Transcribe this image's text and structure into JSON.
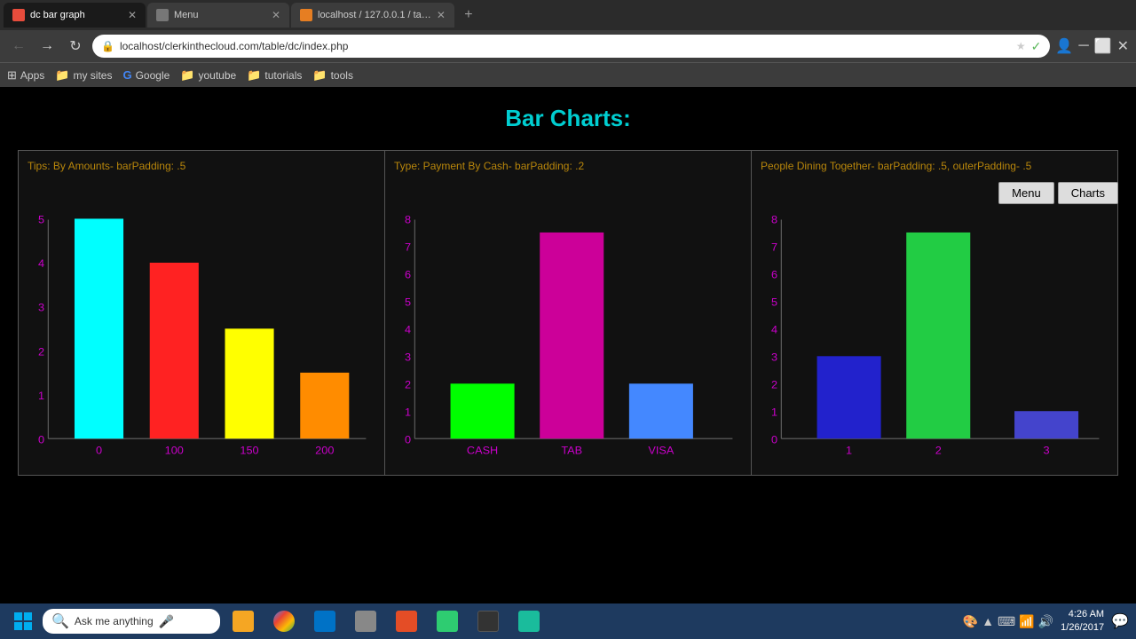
{
  "browser": {
    "tabs": [
      {
        "id": "tab1",
        "title": "dc bar graph",
        "favicon": "graph",
        "active": true,
        "url": "localhost/clerkinthecloud.com/table/dc/index.php"
      },
      {
        "id": "tab2",
        "title": "Menu",
        "favicon": "menu",
        "active": false,
        "url": ""
      },
      {
        "id": "tab3",
        "title": "localhost / 127.0.0.1 / ta…",
        "favicon": "server",
        "active": false,
        "url": ""
      }
    ],
    "address": "localhost/clerkinthecloud.com/table/dc/index.php",
    "bookmarks": [
      {
        "label": "Apps",
        "type": "apps"
      },
      {
        "label": "my sites",
        "type": "folder"
      },
      {
        "label": "Google",
        "type": "google"
      },
      {
        "label": "youtube",
        "type": "folder"
      },
      {
        "label": "tutorials",
        "type": "folder"
      },
      {
        "label": "tools",
        "type": "folder"
      }
    ]
  },
  "page": {
    "title": "Bar Charts:",
    "buttons": {
      "menu": "Menu",
      "charts": "Charts"
    }
  },
  "charts": [
    {
      "id": "chart1",
      "label": "Tips: By Amounts- barPadding: .5",
      "yMax": 5,
      "yTicks": [
        0,
        1,
        2,
        3,
        4,
        5
      ],
      "bars": [
        {
          "label": "0",
          "value": 5,
          "color": "#00ffff"
        },
        {
          "label": "100",
          "value": 4,
          "color": "#ff2222"
        },
        {
          "label": "150",
          "value": 2.5,
          "color": "#ffff00"
        },
        {
          "label": "200",
          "value": 1.5,
          "color": "#ff8c00"
        }
      ]
    },
    {
      "id": "chart2",
      "label": "Type: Payment By Cash- barPadding: .2",
      "yMax": 8,
      "yTicks": [
        0,
        1,
        2,
        3,
        4,
        5,
        6,
        7,
        8
      ],
      "bars": [
        {
          "label": "CASH",
          "value": 2,
          "color": "#00ff00"
        },
        {
          "label": "TAB",
          "value": 7.5,
          "color": "#cc0099"
        },
        {
          "label": "VISA",
          "value": 2,
          "color": "#4488ff"
        }
      ]
    },
    {
      "id": "chart3",
      "label": "People Dining Together- barPadding: .5, outerPadding- .5",
      "yMax": 8,
      "yTicks": [
        0,
        1,
        2,
        3,
        4,
        5,
        6,
        7,
        8
      ],
      "bars": [
        {
          "label": "1",
          "value": 3,
          "color": "#2222cc"
        },
        {
          "label": "2",
          "value": 7.5,
          "color": "#22cc44"
        },
        {
          "label": "3",
          "value": 1,
          "color": "#4444cc"
        }
      ]
    }
  ],
  "taskbar": {
    "search_placeholder": "Ask me anything",
    "time": "4:26 AM",
    "date": "1/26/2017"
  }
}
